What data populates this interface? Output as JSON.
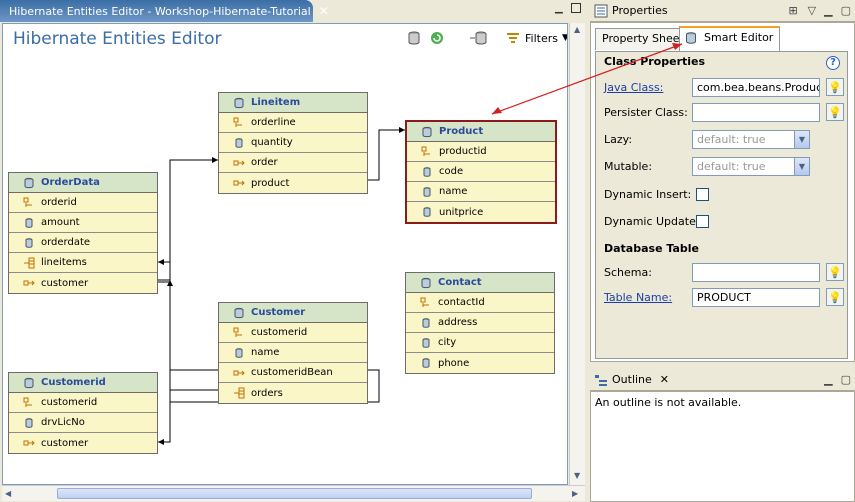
{
  "editor": {
    "tab_label": "Hibernate Entities Editor - Workshop-Hibernate-Tutorial",
    "tab_close": "✕",
    "title": "Hibernate Entities Editor",
    "filters_label": "Filters"
  },
  "entities": {
    "lineitem": {
      "name": "Lineitem",
      "fields": [
        "orderline",
        "quantity",
        "order",
        "product"
      ]
    },
    "product": {
      "name": "Product",
      "fields": [
        "productid",
        "code",
        "name",
        "unitprice"
      ]
    },
    "orderdata": {
      "name": "OrderData",
      "fields": [
        "orderid",
        "amount",
        "orderdate",
        "lineitems",
        "customer"
      ]
    },
    "contact": {
      "name": "Contact",
      "fields": [
        "contactId",
        "address",
        "city",
        "phone"
      ]
    },
    "customer": {
      "name": "Customer",
      "fields": [
        "customerid",
        "name",
        "customeridBean",
        "orders"
      ]
    },
    "customerid": {
      "name": "Customerid",
      "fields": [
        "customerid",
        "drvLicNo",
        "customer"
      ]
    }
  },
  "properties": {
    "title": "Properties",
    "tabs": [
      "Property Sheet",
      "Smart Editor"
    ],
    "class_section": "Class Properties",
    "java_class_label": "Java Class:",
    "java_class_value": "com.bea.beans.Product",
    "persister_label": "Persister Class:",
    "persister_value": "",
    "lazy_label": "Lazy:",
    "lazy_value": "default: true",
    "mutable_label": "Mutable:",
    "mutable_value": "default: true",
    "dynamic_insert_label": "Dynamic Insert:",
    "dynamic_update_label": "Dynamic Update:",
    "db_section": "Database Table",
    "schema_label": "Schema:",
    "schema_value": "",
    "table_label": "Table Name:",
    "table_value": "PRODUCT",
    "help": "?"
  },
  "outline": {
    "title": "Outline",
    "message": "An outline is not available."
  },
  "colors": {
    "accent": "#3a6ea5",
    "selection": "#8b1a1a",
    "arrow": "#d42020"
  }
}
